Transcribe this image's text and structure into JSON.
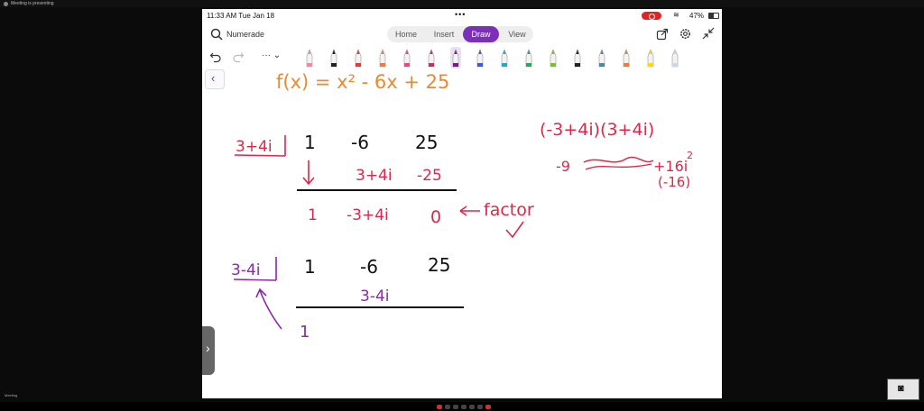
{
  "meeting_bar": {
    "title": "Meeting is presenting"
  },
  "status": {
    "time": "11:33 AM  Tue Jan 18",
    "dots": "•••",
    "battery": "47%"
  },
  "app": {
    "brand": "Numerade",
    "tabs": [
      "Home",
      "Insert",
      "Draw",
      "View"
    ],
    "active_tab": "Draw",
    "more_label": "··· ⌄",
    "accent": "#7c2fb8"
  },
  "tools": [
    "#e98aa6",
    "#222222",
    "#e23a3a",
    "#f07a3a",
    "#e84a7a",
    "#c0306a",
    "#7a1a8a",
    "#3a5ad8",
    "#22aacc",
    "#2aa85a",
    "#7ac02a",
    "#222222",
    "#4a8aa0",
    "#f07a3a",
    "#ffd800",
    "#c8d8e8"
  ],
  "notes": {
    "function": "f(x) = x² - 6x + 25",
    "row1_divisor": "3+4i",
    "row1_coeffs": [
      "1",
      "-6",
      "25"
    ],
    "row1_mid": [
      "3+4i",
      "-25"
    ],
    "row1_result": [
      "1",
      "-3+4i",
      "0"
    ],
    "factor_note": "factor",
    "product": "(-3+4i)(3+4i)",
    "expand": "-9",
    "expand_right": "+16i",
    "expand_exp": "2",
    "neg16": "(-16)",
    "row2_divisor": "3-4i",
    "row2_coeffs": [
      "1",
      "-6",
      "25"
    ],
    "row2_mid": "3-4i",
    "row2_result": "1"
  },
  "footer": {
    "participant": "Meeting",
    "controls": 7
  }
}
